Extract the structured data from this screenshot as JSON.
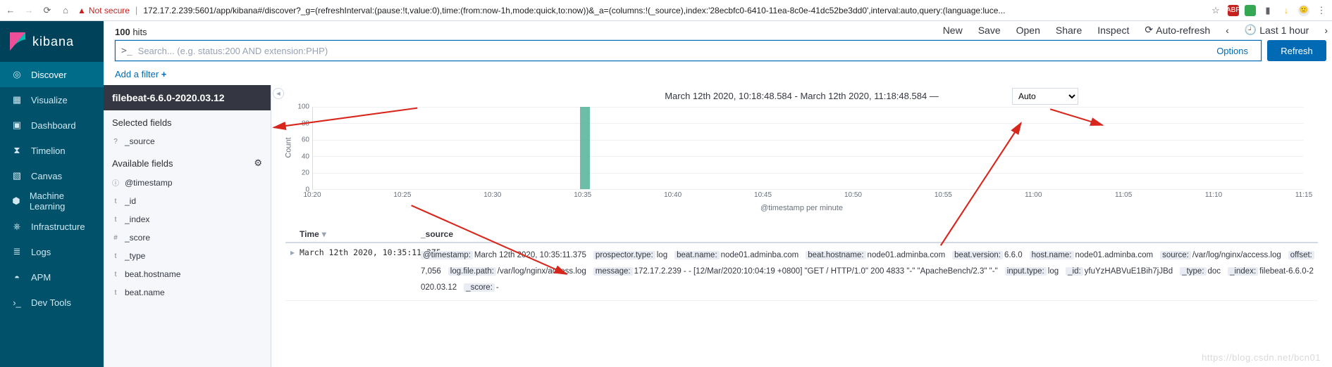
{
  "chrome": {
    "warn_label": "Not secure",
    "url": "172.17.2.239:5601/app/kibana#/discover?_g=(refreshInterval:(pause:!t,value:0),time:(from:now-1h,mode:quick,to:now))&_a=(columns:!(_source),index:'28ecbfc0-6410-11ea-8c0e-41dc52be3dd0',interval:auto,query:(language:luce..."
  },
  "sidebar": {
    "brand": "kibana",
    "items": [
      {
        "label": "Discover",
        "active": true
      },
      {
        "label": "Visualize"
      },
      {
        "label": "Dashboard"
      },
      {
        "label": "Timelion"
      },
      {
        "label": "Canvas"
      },
      {
        "label": "Machine Learning"
      },
      {
        "label": "Infrastructure"
      },
      {
        "label": "Logs"
      },
      {
        "label": "APM"
      },
      {
        "label": "Dev Tools"
      }
    ]
  },
  "header": {
    "hits_count": "100",
    "hits_label": "hits",
    "actions": {
      "new": "New",
      "save": "Save",
      "open": "Open",
      "share": "Share",
      "inspect": "Inspect",
      "autorefresh": "Auto-refresh",
      "timerange": "Last 1 hour"
    },
    "search_placeholder": "Search... (e.g. status:200 AND extension:PHP)",
    "options_label": "Options",
    "refresh_label": "Refresh",
    "add_filter_label": "Add a filter"
  },
  "fields": {
    "index_pattern": "filebeat-6.6.0-2020.03.12",
    "selected_label": "Selected fields",
    "selected": [
      {
        "badge": "?",
        "name": "_source"
      }
    ],
    "available_label": "Available fields",
    "available": [
      {
        "badge": "ⓘ",
        "name": "@timestamp"
      },
      {
        "badge": "t",
        "name": "_id"
      },
      {
        "badge": "t",
        "name": "_index"
      },
      {
        "badge": "#",
        "name": "_score"
      },
      {
        "badge": "t",
        "name": "_type"
      },
      {
        "badge": "t",
        "name": "beat.hostname"
      },
      {
        "badge": "t",
        "name": "beat.name"
      }
    ]
  },
  "histogram": {
    "range_label": "March 12th 2020, 10:18:48.584 - March 12th 2020, 11:18:48.584 —",
    "interval_value": "Auto",
    "xlabel": "@timestamp per minute",
    "ylabel": "Count"
  },
  "chart_data": {
    "type": "bar",
    "categories": [
      "10:20",
      "10:25",
      "10:30",
      "10:35",
      "10:40",
      "10:45",
      "10:50",
      "10:55",
      "11:00",
      "11:05",
      "11:10",
      "11:15"
    ],
    "values": [
      0,
      0,
      0,
      100,
      0,
      0,
      0,
      0,
      0,
      0,
      0,
      0
    ],
    "ylim": [
      0,
      100
    ],
    "yticks": [
      0,
      20,
      40,
      60,
      80,
      100
    ],
    "title": "",
    "xlabel": "@timestamp per minute",
    "ylabel": "Count"
  },
  "table": {
    "time_header": "Time",
    "source_header": "_source",
    "rows": [
      {
        "time": "March 12th 2020, 10:35:11.375",
        "kv": [
          {
            "k": "@timestamp:",
            "v": "March 12th 2020, 10:35:11.375"
          },
          {
            "k": "prospector.type:",
            "v": "log"
          },
          {
            "k": "beat.name:",
            "v": "node01.adminba.com"
          },
          {
            "k": "beat.hostname:",
            "v": "node01.adminba.com"
          },
          {
            "k": "beat.version:",
            "v": "6.6.0"
          },
          {
            "k": "host.name:",
            "v": "node01.adminba.com"
          },
          {
            "k": "source:",
            "v": "/var/log/nginx/access.log"
          },
          {
            "k": "offset:",
            "v": "7,056"
          },
          {
            "k": "log.file.path:",
            "v": "/var/log/nginx/access.log"
          },
          {
            "k": "message:",
            "v": "172.17.2.239 - - [12/Mar/2020:10:04:19 +0800] \"GET / HTTP/1.0\" 200 4833 \"-\" \"ApacheBench/2.3\" \"-\""
          },
          {
            "k": "input.type:",
            "v": "log"
          },
          {
            "k": "_id:",
            "v": "yfuYzHABVuE1Bih7jJBd"
          },
          {
            "k": "_type:",
            "v": "doc"
          },
          {
            "k": "_index:",
            "v": "filebeat-6.6.0-2020.03.12"
          },
          {
            "k": "_score:",
            "v": "-"
          }
        ]
      }
    ]
  },
  "watermark": "https://blog.csdn.net/bcn01"
}
